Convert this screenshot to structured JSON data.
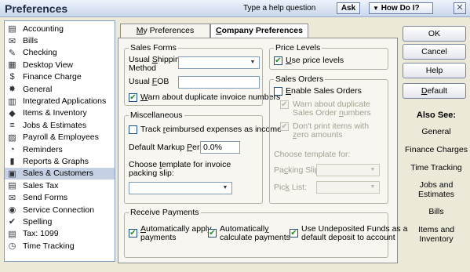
{
  "window": {
    "title": "Preferences",
    "help_prompt": "Type a help question",
    "ask_label": "Ask",
    "howdo_label": "How Do I?",
    "close_glyph": "✕"
  },
  "sidebar": {
    "items": [
      {
        "label": "Accounting",
        "icon": "accounting-icon"
      },
      {
        "label": "Bills",
        "icon": "bills-icon"
      },
      {
        "label": "Checking",
        "icon": "checking-icon"
      },
      {
        "label": "Desktop View",
        "icon": "desktop-view-icon"
      },
      {
        "label": "Finance Charge",
        "icon": "finance-charge-icon"
      },
      {
        "label": "General",
        "icon": "general-icon"
      },
      {
        "label": "Integrated Applications",
        "icon": "integrated-apps-icon"
      },
      {
        "label": "Items & Inventory",
        "icon": "items-inventory-icon"
      },
      {
        "label": "Jobs & Estimates",
        "icon": "jobs-estimates-icon"
      },
      {
        "label": "Payroll & Employees",
        "icon": "payroll-icon"
      },
      {
        "label": "Reminders",
        "icon": "reminders-icon"
      },
      {
        "label": "Reports & Graphs",
        "icon": "reports-graphs-icon"
      },
      {
        "label": "Sales & Customers",
        "icon": "sales-customers-icon",
        "selected": true
      },
      {
        "label": "Sales Tax",
        "icon": "sales-tax-icon"
      },
      {
        "label": "Send Forms",
        "icon": "send-forms-icon"
      },
      {
        "label": "Service Connection",
        "icon": "service-connection-icon"
      },
      {
        "label": "Spelling",
        "icon": "spelling-icon"
      },
      {
        "label": "Tax: 1099",
        "icon": "tax-1099-icon"
      },
      {
        "label": "Time Tracking",
        "icon": "time-tracking-icon"
      }
    ]
  },
  "tabs": {
    "my": {
      "pre": "",
      "key": "M",
      "post": "y Preferences"
    },
    "company": {
      "pre": "",
      "key": "C",
      "post": "ompany Preferences"
    }
  },
  "sales_forms": {
    "title": "Sales Forms",
    "shipping_label_a": {
      "pre": "Usual ",
      "key": "S",
      "post": "hipping"
    },
    "shipping_label_b": "Method",
    "fob_label": {
      "pre": "Usual ",
      "key": "F",
      "post": "OB"
    },
    "fob_value": "",
    "warn_duplicate": {
      "pre": "",
      "key": "W",
      "post": "arn about duplicate invoice numbers",
      "checked": true
    }
  },
  "miscellaneous": {
    "title": "Miscellaneous",
    "track_reimbursed": {
      "pre": "Track ",
      "key": "r",
      "post": "eimbursed expenses as income",
      "checked": false
    },
    "markup_label": {
      "pre": "Default Markup ",
      "key": "P",
      "post": "ercentage"
    },
    "markup_value": "0.0%",
    "packing_label_a": {
      "pre": "Choose ",
      "key": "t",
      "post": "emplate for invoice"
    },
    "packing_label_b": "packing slip:"
  },
  "price_levels": {
    "title": "Price Levels",
    "use_price": {
      "pre": "",
      "key": "U",
      "post": "se price levels",
      "checked": true
    }
  },
  "sales_orders": {
    "title": "Sales Orders",
    "enable": {
      "pre": "",
      "key": "E",
      "post": "nable Sales Orders",
      "checked": false
    },
    "warn_a": "Warn about duplicate",
    "warn_b": {
      "pre": "Sales Order ",
      "key": "n",
      "post": "umbers"
    },
    "dont_print_a": "Don't print items with",
    "dont_print_b": {
      "pre": "",
      "key": "z",
      "post": "ero amounts"
    },
    "choose_template": "Choose template for:",
    "packing_slip": {
      "pre": "Pa",
      "key": "c",
      "post": "king Slip:"
    },
    "pick_list": {
      "pre": "Pic",
      "key": "k",
      "post": " List:"
    }
  },
  "receive_payments": {
    "title": "Receive Payments",
    "auto_apply_a": {
      "pre": "",
      "key": "A",
      "post": "utomatically apply"
    },
    "auto_apply_b": "payments",
    "auto_calc_a": {
      "pre": "Automaticall",
      "key": "y",
      "post": ""
    },
    "auto_calc_b": "calculate payments",
    "undeposited_a": "Use Undeposited Funds as a",
    "undeposited_b": "default deposit to account"
  },
  "buttons": {
    "ok": "OK",
    "cancel": "Cancel",
    "help": "Help",
    "default": {
      "pre": "",
      "key": "D",
      "post": "efault"
    }
  },
  "also_see": {
    "title": "Also See:",
    "links": [
      "General",
      "Finance Charges",
      "Time Tracking",
      "Jobs and\nEstimates",
      "Bills",
      "Items and\nInventory"
    ]
  },
  "colors": {
    "accent": "#c5d0e4",
    "check": "#228b22"
  }
}
